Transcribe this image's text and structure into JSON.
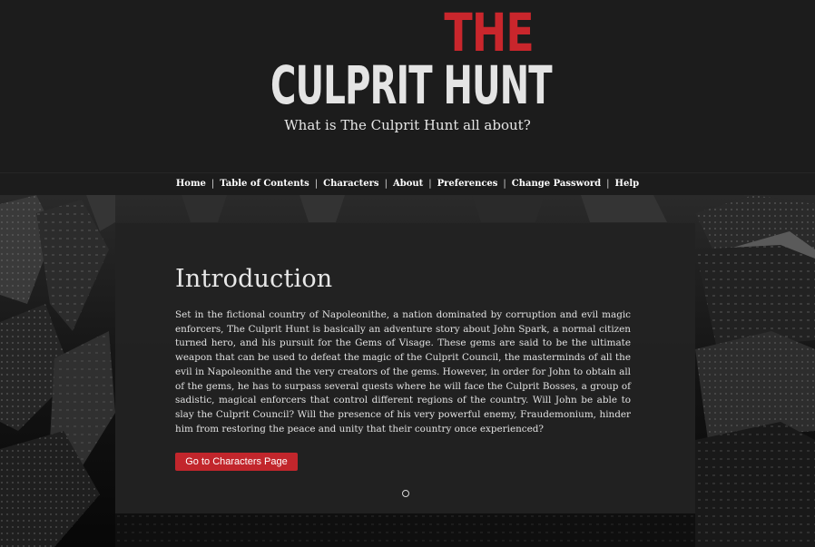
{
  "header": {
    "logo_the": "THE",
    "logo_main": "CULPRIT HUNT",
    "tagline": "What is The Culprit Hunt all about?"
  },
  "nav": {
    "separator": "|",
    "items": [
      {
        "label": "Home"
      },
      {
        "label": "Table of Contents"
      },
      {
        "label": "Characters"
      },
      {
        "label": "About"
      },
      {
        "label": "Preferences"
      },
      {
        "label": "Change Password"
      },
      {
        "label": "Help"
      }
    ]
  },
  "main": {
    "title": "Introduction",
    "body": "Set in the fictional country of Napoleonithe, a nation dominated by corruption and evil magic enforcers, The Culprit Hunt is basically an adventure story about John Spark, a normal citizen turned hero, and his pursuit for the Gems of Visage. These gems are said to be the ultimate weapon that can be used to defeat the magic of the Culprit Council, the masterminds of all the evil in Napoleonithe and the very creators of the gems. However, in order for John to obtain all of the gems, he has to surpass several quests where he will face the Culprit Bosses, a group of sadistic, magical enforcers that control different regions of the country. Will John be able to slay the Culprit Council? Will the presence of his very powerful enemy, Fraudemonium, hinder him from restoring the peace and unity that their country once experienced?",
    "cta_label": "Go to Characters Page",
    "slide_indicator_count": 1
  },
  "colors": {
    "accent_red": "#c9262c",
    "header_bg": "#1c1c1c",
    "panel_bg": "#222222",
    "text_light": "#e8e8e8"
  }
}
